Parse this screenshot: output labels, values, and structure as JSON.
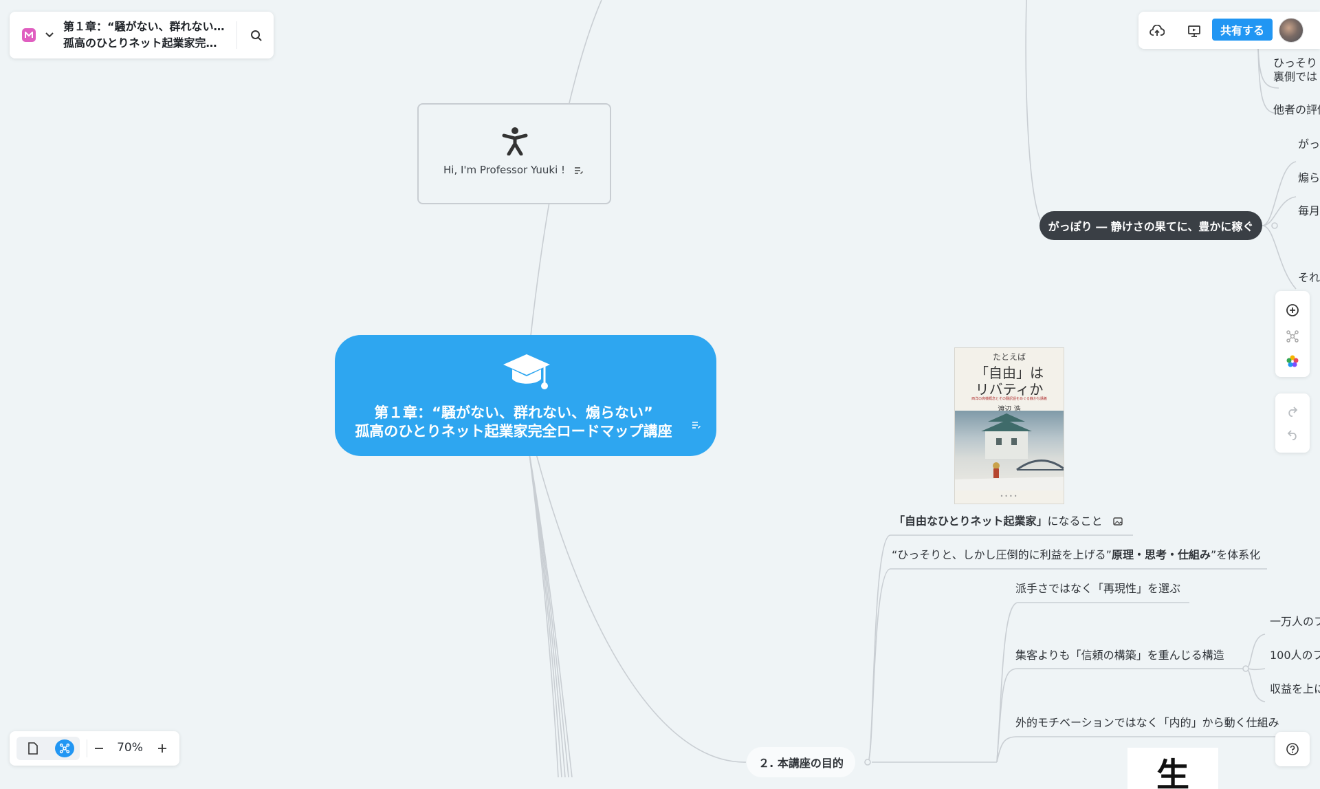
{
  "header": {
    "title_line1": "第１章：“騒がない、群れない…",
    "title_line2": "孤高のひとりネット起業家完…"
  },
  "toolbar": {
    "share_label": "共有する"
  },
  "mindmap": {
    "central": {
      "line1": "第１章：“騒がない、群れない、煽らない”",
      "line2": "孤高のひとりネット起業家完全ロードマップ講座",
      "color": "#2ea6f0"
    },
    "intro_card": {
      "text": "Hi, I'm Professor Yuuki !"
    },
    "dark_node": {
      "text": "がっぽり ― 静けさの果てに、豊かに稼ぐ"
    },
    "right_edge_items": [
      "ひっそり",
      "裏側では",
      "他者の評価",
      "がっ",
      "煽ら",
      "毎月",
      "それ"
    ],
    "book": {
      "small": "たとえば",
      "title": "「自由」は",
      "title2": "リバティか",
      "subtitle": "西洋の高機概念とその翻訳語をめぐる静かな講義",
      "author": "渡辺 浩"
    },
    "branch_items": [
      {
        "bold": "「自由なひとりネット起業家」",
        "rest": "になること"
      },
      {
        "pre": "“ひっそりと、しかし圧倒的に利益を上げる”",
        "bold": "原理・思考・仕組み",
        "rest": "”を体系化"
      }
    ],
    "sub_items": [
      "派手さではなく「再現性」を選ぶ",
      "集客よりも「信頼の構築」を重んじる構造",
      "外的モチベーションではなく「内的」から動く仕組み"
    ],
    "sub_sub_items": [
      "一万人のフ",
      "100人のフ",
      "収益を上に"
    ],
    "section_node": "２. 本講座の目的",
    "kanji_card": "生"
  },
  "zoom": {
    "level": "70%"
  }
}
